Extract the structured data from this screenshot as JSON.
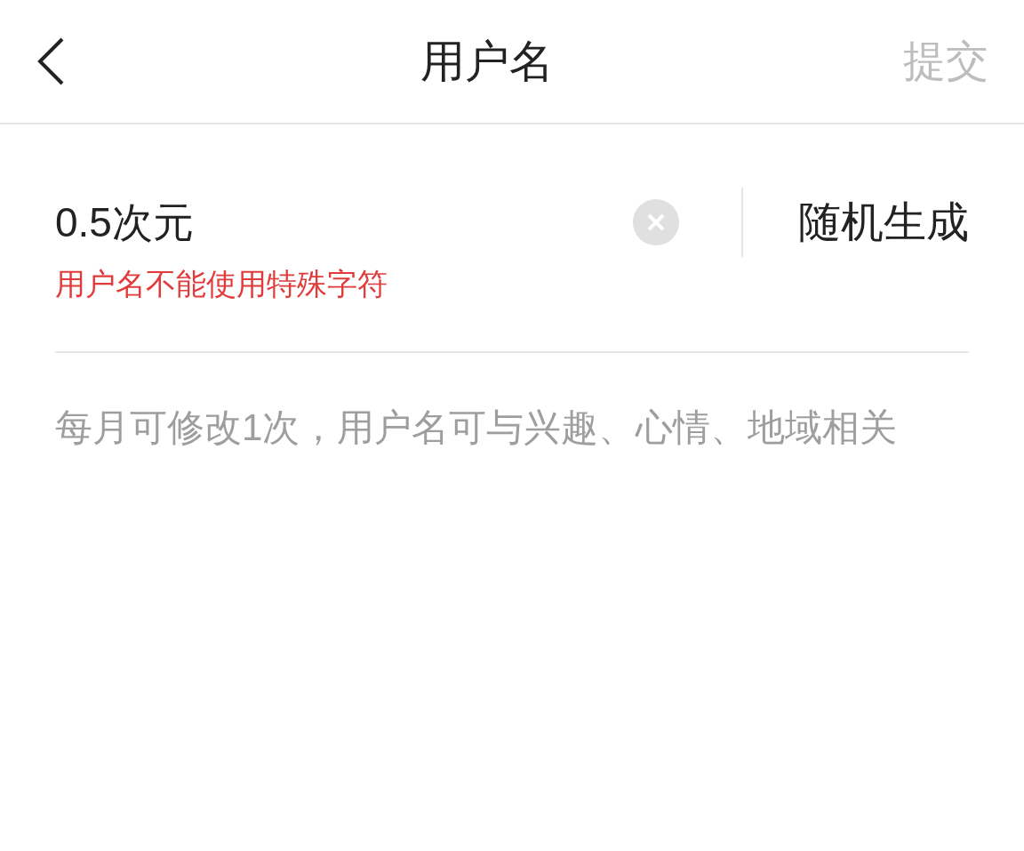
{
  "header": {
    "title": "用户名",
    "submit": {
      "label": "提交",
      "disabled": true
    }
  },
  "username_field": {
    "value": "0.5次元",
    "error": "用户名不能使用特殊字符"
  },
  "random_button": {
    "label": "随机生成"
  },
  "hint": "每月可修改1次，用户名可与兴趣、心情、地域相关"
}
